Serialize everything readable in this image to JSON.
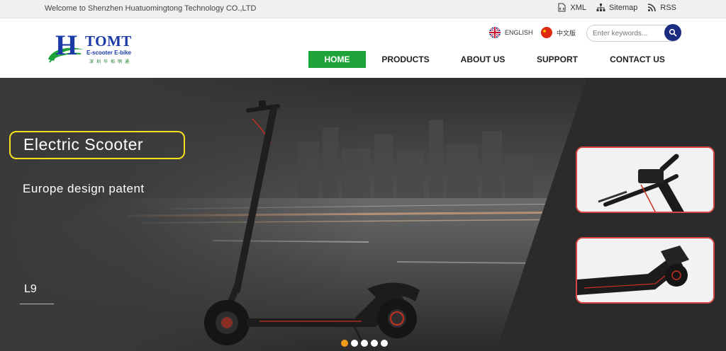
{
  "topbar": {
    "welcome": "Welcome to Shenzhen Huatuomingtong Technology CO.,LTD",
    "links": [
      {
        "label": "XML",
        "icon": "xml-icon"
      },
      {
        "label": "Sitemap",
        "icon": "sitemap-icon"
      },
      {
        "label": "RSS",
        "icon": "rss-icon"
      }
    ]
  },
  "logo": {
    "letter": "H",
    "brand": "TOMT",
    "subtitle": "E-scooter  E-bike",
    "chinese": "深圳华拓明通"
  },
  "languages": [
    {
      "label": "ENGLISH",
      "icon": "uk-flag-icon"
    },
    {
      "label": "中文版",
      "icon": "china-flag-icon"
    }
  ],
  "search": {
    "placeholder": "Enter keywords...",
    "value": ""
  },
  "nav": [
    {
      "label": "HOME",
      "active": true
    },
    {
      "label": "PRODUCTS",
      "active": false
    },
    {
      "label": "ABOUT US",
      "active": false
    },
    {
      "label": "SUPPORT",
      "active": false
    },
    {
      "label": "CONTACT US",
      "active": false
    }
  ],
  "banner": {
    "title": "Electric Scooter",
    "subtitle": "Europe design patent",
    "model": "L9",
    "slide_count": 5,
    "active_slide": 1
  },
  "colors": {
    "brand_blue": "#1a3aa8",
    "brand_green": "#1ea33a",
    "highlight_yellow": "#f4e01c",
    "thumb_border": "#d64545",
    "active_dot": "#f29a1a"
  }
}
